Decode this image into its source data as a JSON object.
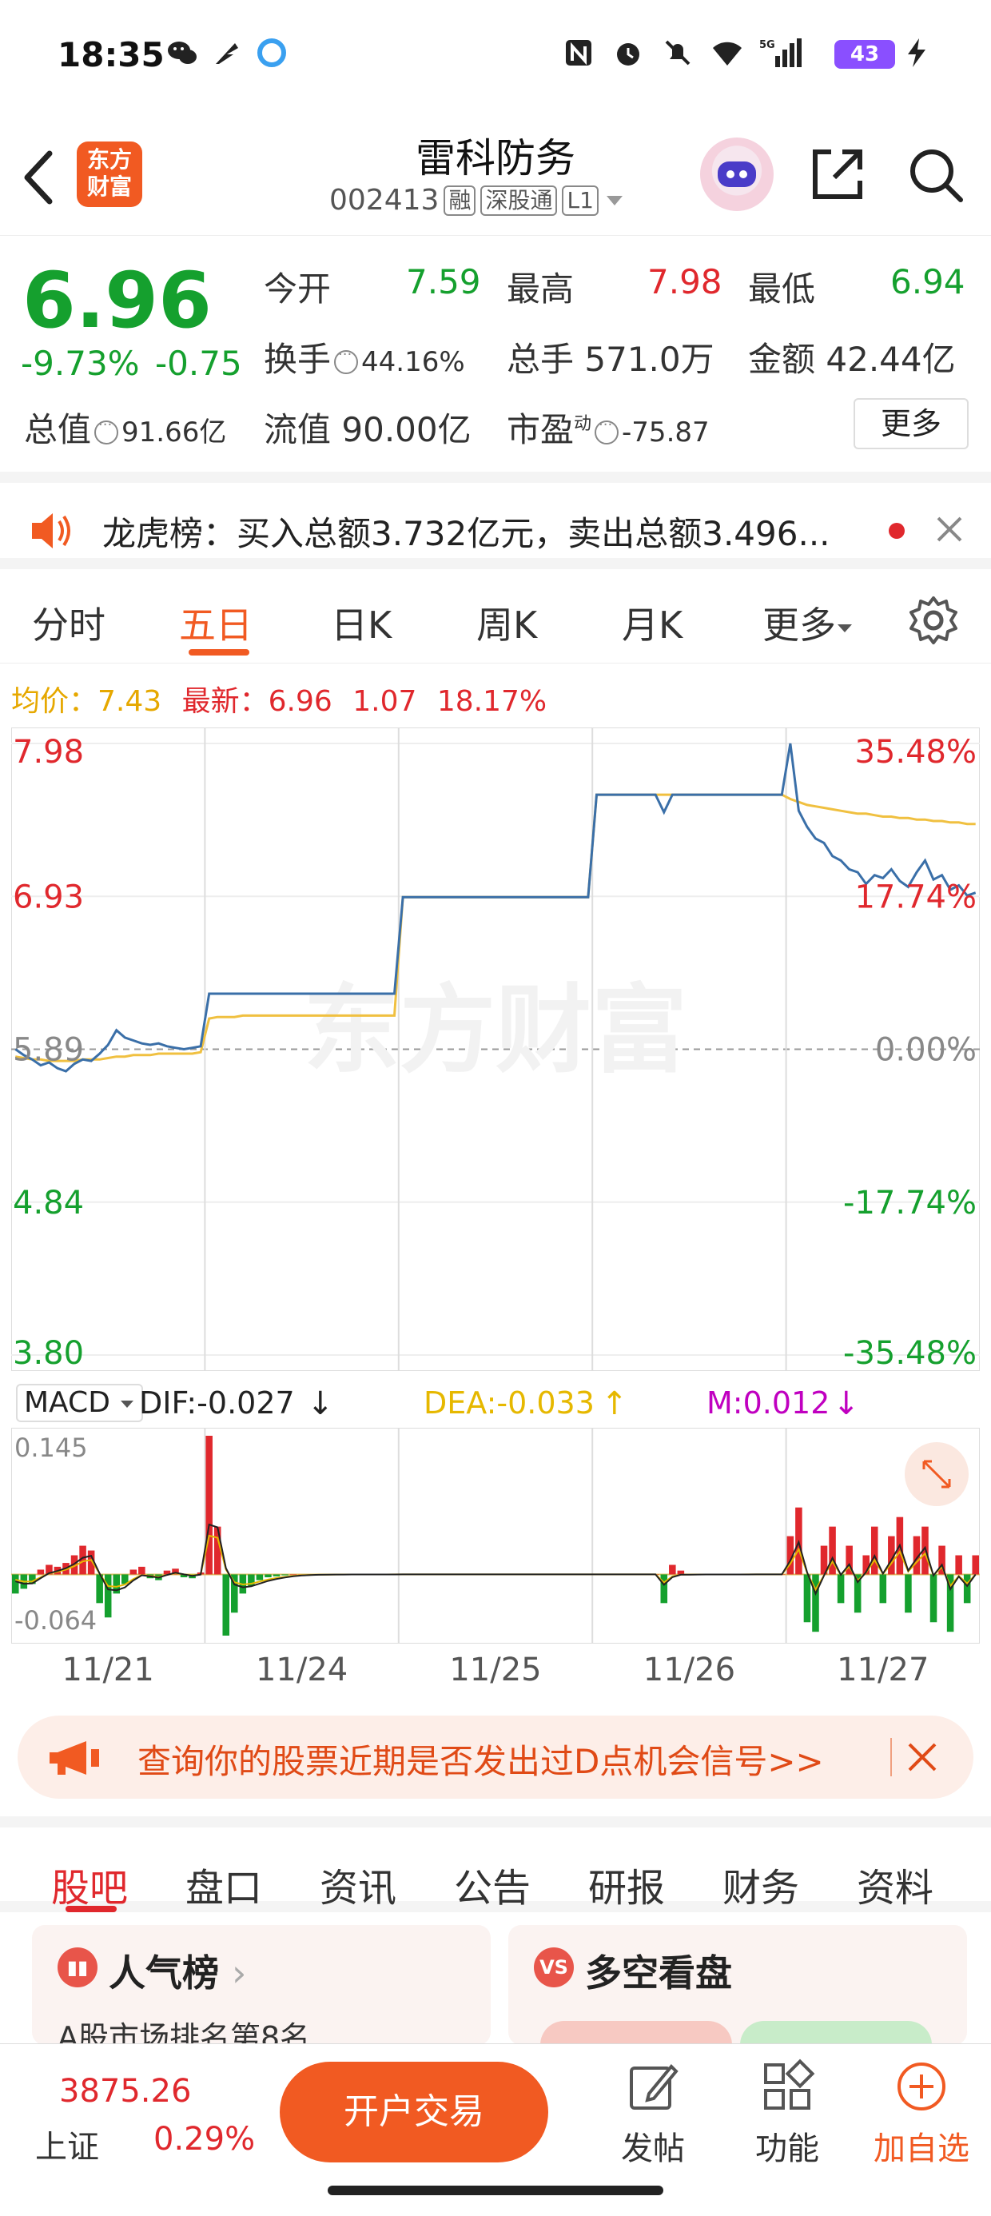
{
  "status_bar": {
    "time": "18:35",
    "battery": "43"
  },
  "header": {
    "stock_name": "雷科防务",
    "stock_code": "002413",
    "tags": [
      "融",
      "深股通",
      "L1"
    ],
    "logo_text_1": "东方",
    "logo_text_2": "财富"
  },
  "quote": {
    "price": "6.96",
    "change_pct": "-9.73%",
    "change_amt": "-0.75",
    "fields": {
      "open_label": "今开",
      "open_value": "7.59",
      "high_label": "最高",
      "high_value": "7.98",
      "low_label": "最低",
      "low_value": "6.94",
      "turnover_label": "换手",
      "turnover_value": "44.16%",
      "volume_label": "总手",
      "volume_value": "571.0万",
      "amount_label": "金额",
      "amount_value": "42.44亿",
      "total_cap_label": "总值",
      "total_cap_value": "91.66亿",
      "float_cap_label": "流值",
      "float_cap_value": "90.00亿",
      "pe_label": "市盈",
      "pe_sup": "动",
      "pe_value": "-75.87"
    },
    "more_label": "更多"
  },
  "notice": {
    "text": "龙虎榜：买入总额3.732亿元，卖出总额3.496..."
  },
  "chart_tabs": {
    "items": [
      "分时",
      "五日",
      "日K",
      "周K",
      "月K",
      "更多"
    ],
    "active": "五日"
  },
  "avg_row": {
    "avg_label": "均价：",
    "avg_value": "7.43",
    "latest_label": "最新：",
    "latest_value": "6.96",
    "latest_change": "1.07",
    "latest_pct": "18.17%"
  },
  "chart_data": {
    "type": "line",
    "title": "",
    "x_labels": [
      "11/21",
      "11/24",
      "11/25",
      "11/26",
      "11/27"
    ],
    "y_ticks_left": [
      "7.98",
      "6.93",
      "5.89",
      "4.84",
      "3.80"
    ],
    "y_ticks_right": [
      "35.48%",
      "17.74%",
      "0.00%",
      "-17.74%",
      "-35.48%"
    ],
    "ylim": [
      3.8,
      7.98
    ],
    "base": 5.89,
    "series": [
      {
        "name": "price",
        "color": "#3a6fa8",
        "values": [
          5.89,
          5.85,
          5.82,
          5.78,
          5.8,
          5.76,
          5.74,
          5.79,
          5.82,
          5.81,
          5.86,
          5.92,
          6.02,
          5.97,
          5.95,
          5.93,
          5.92,
          5.93,
          5.91,
          5.9,
          5.89,
          5.9,
          5.91,
          6.27,
          6.27,
          6.27,
          6.27,
          6.27,
          6.27,
          6.27,
          6.27,
          6.27,
          6.27,
          6.27,
          6.27,
          6.27,
          6.27,
          6.27,
          6.27,
          6.27,
          6.27,
          6.27,
          6.27,
          6.27,
          6.27,
          6.27,
          6.93,
          6.93,
          6.93,
          6.93,
          6.93,
          6.93,
          6.93,
          6.93,
          6.93,
          6.93,
          6.93,
          6.93,
          6.93,
          6.93,
          6.93,
          6.93,
          6.93,
          6.93,
          6.93,
          6.93,
          6.93,
          6.93,
          6.93,
          7.63,
          7.63,
          7.63,
          7.63,
          7.63,
          7.63,
          7.63,
          7.63,
          7.51,
          7.63,
          7.63,
          7.63,
          7.63,
          7.63,
          7.63,
          7.63,
          7.63,
          7.63,
          7.63,
          7.63,
          7.63,
          7.63,
          7.63,
          7.98,
          7.52,
          7.41,
          7.33,
          7.3,
          7.21,
          7.18,
          7.12,
          7.1,
          7.02,
          7.08,
          7.06,
          7.12,
          7.04,
          7.0,
          7.1,
          7.18,
          7.05,
          7.08,
          6.98,
          7.01,
          6.94,
          6.96
        ]
      },
      {
        "name": "avg",
        "color": "#f0c040",
        "values": [
          5.84,
          5.83,
          5.82,
          5.82,
          5.81,
          5.81,
          5.81,
          5.81,
          5.82,
          5.82,
          5.82,
          5.83,
          5.84,
          5.84,
          5.85,
          5.85,
          5.85,
          5.86,
          5.86,
          5.86,
          5.86,
          5.86,
          5.87,
          6.1,
          6.11,
          6.11,
          6.11,
          6.12,
          6.12,
          6.12,
          6.12,
          6.12,
          6.12,
          6.12,
          6.12,
          6.12,
          6.12,
          6.12,
          6.12,
          6.12,
          6.12,
          6.12,
          6.12,
          6.12,
          6.12,
          6.12,
          6.93,
          6.93,
          6.93,
          6.93,
          6.93,
          6.93,
          6.93,
          6.93,
          6.93,
          6.93,
          6.93,
          6.93,
          6.93,
          6.93,
          6.93,
          6.93,
          6.93,
          6.93,
          6.93,
          6.93,
          6.93,
          6.93,
          6.93,
          7.63,
          7.63,
          7.63,
          7.63,
          7.63,
          7.63,
          7.63,
          7.63,
          7.63,
          7.63,
          7.63,
          7.63,
          7.63,
          7.63,
          7.63,
          7.63,
          7.63,
          7.63,
          7.63,
          7.63,
          7.63,
          7.63,
          7.63,
          7.6,
          7.58,
          7.56,
          7.55,
          7.54,
          7.53,
          7.52,
          7.51,
          7.5,
          7.5,
          7.49,
          7.48,
          7.48,
          7.47,
          7.47,
          7.46,
          7.46,
          7.45,
          7.45,
          7.44,
          7.44,
          7.43,
          7.43
        ]
      }
    ],
    "watermark": "东方财富"
  },
  "macd": {
    "selector": "MACD",
    "dif_label": "DIF:-0.027",
    "dea_label": "DEA:-0.033",
    "m_label": "M:0.012",
    "colors": {
      "dif": "#222222",
      "dea": "#e6b800",
      "m": "#c000c0",
      "pos": "#e0282d",
      "neg": "#15a02e"
    },
    "y_top": "0.145",
    "y_bottom": "-0.064",
    "ylim": [
      -0.064,
      0.145
    ],
    "hist": [
      -0.02,
      -0.015,
      -0.01,
      0.005,
      0.01,
      0.008,
      0.012,
      0.02,
      0.03,
      0.025,
      -0.03,
      -0.045,
      -0.02,
      -0.01,
      0.005,
      0.008,
      -0.004,
      -0.006,
      0.004,
      0.006,
      -0.003,
      -0.004,
      0.002,
      0.145,
      0.05,
      -0.064,
      -0.04,
      -0.02,
      -0.012,
      -0.006,
      -0.003,
      -0.002,
      -0.001,
      0,
      0,
      0,
      0,
      0,
      0,
      0,
      0,
      0,
      0,
      0,
      0,
      0,
      0,
      0,
      0,
      0,
      0,
      0,
      0,
      0,
      0,
      0,
      0,
      0,
      0,
      0,
      0,
      0,
      0,
      0,
      0,
      0,
      0,
      0,
      0,
      0,
      0,
      0,
      0,
      0,
      0,
      0,
      0,
      -0.03,
      0.01,
      0.004,
      0,
      0,
      0,
      0,
      0,
      0,
      0,
      0,
      0,
      0,
      0,
      0,
      0.04,
      0.07,
      -0.05,
      -0.06,
      0.03,
      0.05,
      -0.03,
      0.03,
      -0.04,
      0.02,
      0.05,
      -0.03,
      0.04,
      0.06,
      -0.04,
      0.04,
      0.05,
      -0.05,
      0.03,
      -0.06,
      0.02,
      -0.03,
      0.02
    ]
  },
  "promo": {
    "text": "查询你的股票近期是否发出过D点机会信号>>"
  },
  "section_tabs": {
    "items": [
      "股吧",
      "盘口",
      "资讯",
      "公告",
      "研报",
      "财务",
      "资料"
    ],
    "active": "股吧"
  },
  "cards": {
    "popularity_title": "人气榜",
    "popularity_sub": "A股市场排名第8名",
    "longshort_title": "多空看盘",
    "longshort_icon": "VS"
  },
  "bottom_bar": {
    "index_value": "3875.26",
    "index_name": "上证",
    "index_change": "0.29%",
    "trade_label": "开户交易",
    "post_label": "发帖",
    "function_label": "功能",
    "watchlist_label": "加自选"
  }
}
